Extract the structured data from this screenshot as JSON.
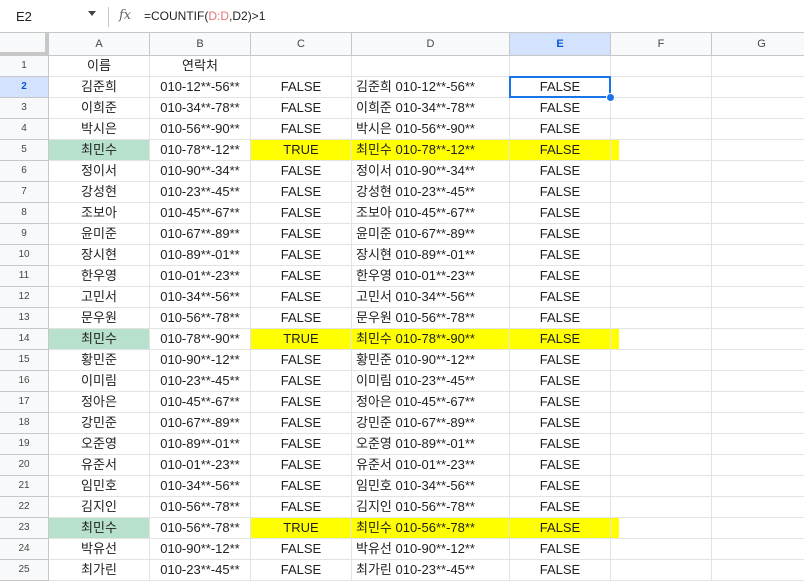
{
  "namebox": "E2",
  "formula": {
    "prefix": "=COUNTIF(",
    "ref1": "D:D",
    "mid": ",D2)>1"
  },
  "columns": [
    "A",
    "B",
    "C",
    "D",
    "E",
    "F",
    "G"
  ],
  "selected_column": "E",
  "selected_row": 2,
  "rows": [
    {
      "n": "1",
      "a": "이름",
      "b": "연락처",
      "c": "",
      "d": "",
      "e": "",
      "hl": ""
    },
    {
      "n": "2",
      "a": "김준희",
      "b": "010-12**-56**",
      "c": "FALSE",
      "d": "김준희 010-12**-56**",
      "e": "FALSE",
      "hl": ""
    },
    {
      "n": "3",
      "a": "이희준",
      "b": "010-34**-78**",
      "c": "FALSE",
      "d": "이희준 010-34**-78**",
      "e": "FALSE",
      "hl": ""
    },
    {
      "n": "4",
      "a": "박시은",
      "b": "010-56**-90**",
      "c": "FALSE",
      "d": "박시은 010-56**-90**",
      "e": "FALSE",
      "hl": ""
    },
    {
      "n": "5",
      "a": "최민수",
      "b": "010-78**-12**",
      "c": "TRUE",
      "d": "최민수 010-78**-12**",
      "e": "FALSE",
      "hl": "dup"
    },
    {
      "n": "6",
      "a": "정이서",
      "b": "010-90**-34**",
      "c": "FALSE",
      "d": "정이서 010-90**-34**",
      "e": "FALSE",
      "hl": ""
    },
    {
      "n": "7",
      "a": "강성현",
      "b": "010-23**-45**",
      "c": "FALSE",
      "d": "강성현 010-23**-45**",
      "e": "FALSE",
      "hl": ""
    },
    {
      "n": "8",
      "a": "조보아",
      "b": "010-45**-67**",
      "c": "FALSE",
      "d": "조보아 010-45**-67**",
      "e": "FALSE",
      "hl": ""
    },
    {
      "n": "9",
      "a": "윤미준",
      "b": "010-67**-89**",
      "c": "FALSE",
      "d": "윤미준 010-67**-89**",
      "e": "FALSE",
      "hl": ""
    },
    {
      "n": "10",
      "a": "장시현",
      "b": "010-89**-01**",
      "c": "FALSE",
      "d": "장시현 010-89**-01**",
      "e": "FALSE",
      "hl": ""
    },
    {
      "n": "11",
      "a": "한우영",
      "b": "010-01**-23**",
      "c": "FALSE",
      "d": "한우영 010-01**-23**",
      "e": "FALSE",
      "hl": ""
    },
    {
      "n": "12",
      "a": "고민서",
      "b": "010-34**-56**",
      "c": "FALSE",
      "d": "고민서 010-34**-56**",
      "e": "FALSE",
      "hl": ""
    },
    {
      "n": "13",
      "a": "문우원",
      "b": "010-56**-78**",
      "c": "FALSE",
      "d": "문우원 010-56**-78**",
      "e": "FALSE",
      "hl": ""
    },
    {
      "n": "14",
      "a": "최민수",
      "b": "010-78**-90**",
      "c": "TRUE",
      "d": "최민수 010-78**-90**",
      "e": "FALSE",
      "hl": "dup"
    },
    {
      "n": "15",
      "a": "황민준",
      "b": "010-90**-12**",
      "c": "FALSE",
      "d": "황민준 010-90**-12**",
      "e": "FALSE",
      "hl": ""
    },
    {
      "n": "16",
      "a": "이미림",
      "b": "010-23**-45**",
      "c": "FALSE",
      "d": "이미림 010-23**-45**",
      "e": "FALSE",
      "hl": ""
    },
    {
      "n": "17",
      "a": "정아은",
      "b": "010-45**-67**",
      "c": "FALSE",
      "d": "정아은 010-45**-67**",
      "e": "FALSE",
      "hl": ""
    },
    {
      "n": "18",
      "a": "강민준",
      "b": "010-67**-89**",
      "c": "FALSE",
      "d": "강민준 010-67**-89**",
      "e": "FALSE",
      "hl": ""
    },
    {
      "n": "19",
      "a": "오준영",
      "b": "010-89**-01**",
      "c": "FALSE",
      "d": "오준영 010-89**-01**",
      "e": "FALSE",
      "hl": ""
    },
    {
      "n": "20",
      "a": "유준서",
      "b": "010-01**-23**",
      "c": "FALSE",
      "d": "유준서 010-01**-23**",
      "e": "FALSE",
      "hl": ""
    },
    {
      "n": "21",
      "a": "임민호",
      "b": "010-34**-56**",
      "c": "FALSE",
      "d": "임민호 010-34**-56**",
      "e": "FALSE",
      "hl": ""
    },
    {
      "n": "22",
      "a": "김지인",
      "b": "010-56**-78**",
      "c": "FALSE",
      "d": "김지인 010-56**-78**",
      "e": "FALSE",
      "hl": ""
    },
    {
      "n": "23",
      "a": "최민수",
      "b": "010-56**-78**",
      "c": "TRUE",
      "d": "최민수 010-56**-78**",
      "e": "FALSE",
      "hl": "dup"
    },
    {
      "n": "24",
      "a": "박유선",
      "b": "010-90**-12**",
      "c": "FALSE",
      "d": "박유선 010-90**-12**",
      "e": "FALSE",
      "hl": ""
    },
    {
      "n": "25",
      "a": "최가린",
      "b": "010-23**-45**",
      "c": "FALSE",
      "d": "최가린 010-23**-45**",
      "e": "FALSE",
      "hl": ""
    }
  ],
  "colors": {
    "highlight_yellow": "#ffff00",
    "highlight_green": "#b7e1cd",
    "selection": "#1a73e8"
  }
}
